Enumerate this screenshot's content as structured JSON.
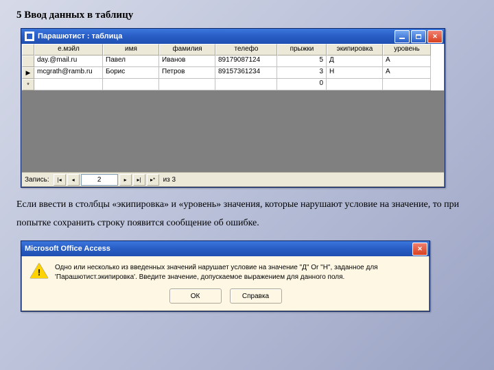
{
  "heading": "5 Ввод данных в таблицу",
  "table_window": {
    "title": "Парашютист : таблица",
    "columns": {
      "email": "е.мэйл",
      "name": "имя",
      "family": "фамилия",
      "phone": "телефо",
      "jumps": "прыжки",
      "equip": "экипировка",
      "level": "уровень"
    },
    "rows": [
      {
        "email": "day.@mail.ru",
        "name": "Павел",
        "family": "Иванов",
        "phone": "89179087124",
        "jumps": "5",
        "equip": "Д",
        "level": "А"
      },
      {
        "email": "mcgrath@ramb.ru",
        "name": "Борис",
        "family": "Петров",
        "phone": "89157361234",
        "jumps": "3",
        "equip": "Н",
        "level": "А"
      },
      {
        "email": "",
        "name": "",
        "family": "",
        "phone": "",
        "jumps": "0",
        "equip": "",
        "level": ""
      }
    ],
    "nav": {
      "label": "Запись:",
      "current": "2",
      "of_label": "из  3"
    }
  },
  "paragraph": "Если ввести в столбцы «экипировка» и «уровень» значения, которые нарушают условие на значение, то при попытке сохранить строку появится сообщение об ошибке.",
  "dialog": {
    "title": "Microsoft Office Access",
    "message": "Одно или несколько из введенных значений нарушает условие на значение \"Д\" Or \"Н\", заданное для 'Парашютист.экипировка'. Введите значение, допускаемое выражением для данного поля.",
    "ok": "ОК",
    "help": "Справка"
  }
}
